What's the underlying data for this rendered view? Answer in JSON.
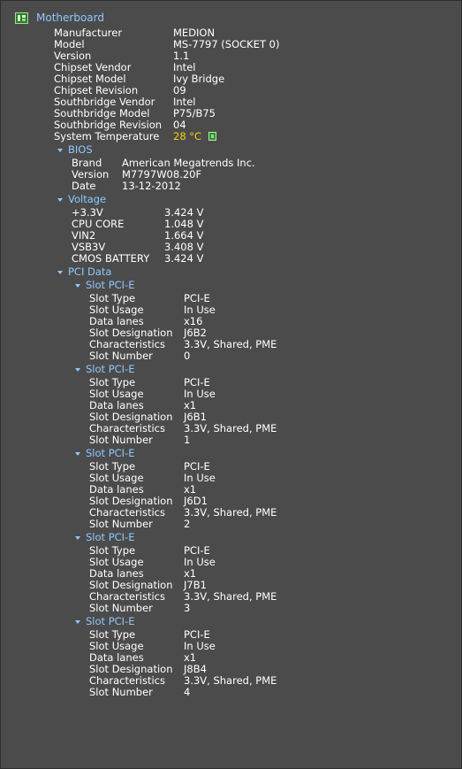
{
  "motherboard": {
    "title": "Motherboard",
    "icon": "motherboard-icon",
    "fields": [
      {
        "key": "Manufacturer",
        "value": "MEDION"
      },
      {
        "key": "Model",
        "value": "MS-7797 (SOCKET 0)"
      },
      {
        "key": "Version",
        "value": "1.1"
      },
      {
        "key": "Chipset Vendor",
        "value": "Intel"
      },
      {
        "key": "Chipset Model",
        "value": "Ivy Bridge"
      },
      {
        "key": "Chipset Revision",
        "value": "09"
      },
      {
        "key": "Southbridge Vendor",
        "value": "Intel"
      },
      {
        "key": "Southbridge Model",
        "value": "P75/B75"
      },
      {
        "key": "Southbridge Revision",
        "value": "04"
      },
      {
        "key": "System Temperature",
        "value": "28 °C"
      }
    ]
  },
  "bios": {
    "title": "BIOS",
    "fields": [
      {
        "key": "Brand",
        "value": "American Megatrends Inc."
      },
      {
        "key": "Version",
        "value": "M7797W08.20F"
      },
      {
        "key": "Date",
        "value": "13-12-2012"
      }
    ]
  },
  "voltage": {
    "title": "Voltage",
    "fields": [
      {
        "key": "+3.3V",
        "value": "3.424 V"
      },
      {
        "key": "CPU CORE",
        "value": "1.048 V"
      },
      {
        "key": "VIN2",
        "value": "1.664 V"
      },
      {
        "key": "VSB3V",
        "value": "3.408 V"
      },
      {
        "key": "CMOS BATTERY",
        "value": "3.424 V"
      }
    ]
  },
  "pci": {
    "title": "PCI Data",
    "slots": [
      {
        "title": "Slot PCI-E",
        "fields": [
          {
            "key": "Slot Type",
            "value": "PCI-E"
          },
          {
            "key": "Slot Usage",
            "value": "In Use"
          },
          {
            "key": "Data lanes",
            "value": "x16"
          },
          {
            "key": "Slot Designation",
            "value": "J6B2"
          },
          {
            "key": "Characteristics",
            "value": "3.3V, Shared, PME"
          },
          {
            "key": "Slot Number",
            "value": "0"
          }
        ]
      },
      {
        "title": "Slot PCI-E",
        "fields": [
          {
            "key": "Slot Type",
            "value": "PCI-E"
          },
          {
            "key": "Slot Usage",
            "value": "In Use"
          },
          {
            "key": "Data lanes",
            "value": "x1"
          },
          {
            "key": "Slot Designation",
            "value": "J6B1"
          },
          {
            "key": "Characteristics",
            "value": "3.3V, Shared, PME"
          },
          {
            "key": "Slot Number",
            "value": "1"
          }
        ]
      },
      {
        "title": "Slot PCI-E",
        "fields": [
          {
            "key": "Slot Type",
            "value": "PCI-E"
          },
          {
            "key": "Slot Usage",
            "value": "In Use"
          },
          {
            "key": "Data lanes",
            "value": "x1"
          },
          {
            "key": "Slot Designation",
            "value": "J6D1"
          },
          {
            "key": "Characteristics",
            "value": "3.3V, Shared, PME"
          },
          {
            "key": "Slot Number",
            "value": "2"
          }
        ]
      },
      {
        "title": "Slot PCI-E",
        "fields": [
          {
            "key": "Slot Type",
            "value": "PCI-E"
          },
          {
            "key": "Slot Usage",
            "value": "In Use"
          },
          {
            "key": "Data lanes",
            "value": "x1"
          },
          {
            "key": "Slot Designation",
            "value": "J7B1"
          },
          {
            "key": "Characteristics",
            "value": "3.3V, Shared, PME"
          },
          {
            "key": "Slot Number",
            "value": "3"
          }
        ]
      },
      {
        "title": "Slot PCI-E",
        "fields": [
          {
            "key": "Slot Type",
            "value": "PCI-E"
          },
          {
            "key": "Slot Usage",
            "value": "In Use"
          },
          {
            "key": "Data lanes",
            "value": "x1"
          },
          {
            "key": "Slot Designation",
            "value": "J8B4"
          },
          {
            "key": "Characteristics",
            "value": "3.3V, Shared, PME"
          },
          {
            "key": "Slot Number",
            "value": "4"
          }
        ]
      }
    ]
  },
  "colors": {
    "background": "#4b4b4b",
    "heading": "#8fc8ff",
    "text": "#ffffff",
    "temperature": "#f2d10f"
  }
}
